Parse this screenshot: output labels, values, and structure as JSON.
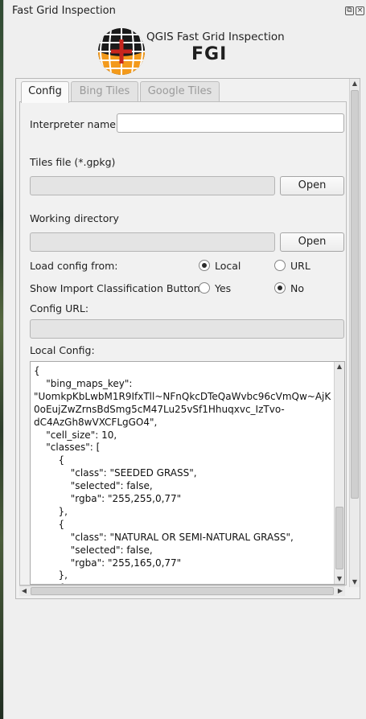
{
  "window": {
    "title": "Fast Grid Inspection"
  },
  "logo": {
    "line1": "QGIS Fast Grid Inspection",
    "line2": "FGI"
  },
  "tabs": [
    {
      "label": "Config",
      "active": true
    },
    {
      "label": "Bing Tiles",
      "active": false
    },
    {
      "label": "Google Tiles",
      "active": false
    }
  ],
  "config": {
    "interpreter_label": "Interpreter name",
    "interpreter_value": "",
    "tiles_file_label": "Tiles file (*.gpkg)",
    "tiles_file_value": "",
    "tiles_open": "Open",
    "working_dir_label": "Working directory",
    "working_dir_value": "",
    "working_dir_open": "Open",
    "load_from_label": "Load config from:",
    "load_from_options": [
      "Local",
      "URL"
    ],
    "load_from_selected": "Local",
    "import_btn_label": "Show Import Classification Button:",
    "import_btn_options": [
      "Yes",
      "No"
    ],
    "import_btn_selected": "No",
    "config_url_label": "Config URL:",
    "config_url_value": "",
    "local_config_label": "Local Config:",
    "local_config_lines": [
      "{",
      "    \"bing_maps_key\":",
      "\"UomkpKbLwbM1R9IfxTll~NFnQkcDTeQaWvbc96cVmQw~AjK",
      "0oEujZwZrnsBdSmg5cM47Lu25vSf1Hhuqxvc_IzTvo-",
      "dC4AzGh8wVXCFLgGO4\",",
      "    \"cell_size\": 10,",
      "    \"classes\": [",
      "        {",
      "            \"class\": \"SEEDED GRASS\",",
      "            \"selected\": false,",
      "            \"rgba\": \"255,255,0,77\"",
      "        },",
      "        {",
      "            \"class\": \"NATURAL OR SEMI-NATURAL GRASS\",",
      "            \"selected\": false,",
      "            \"rgba\": \"255,165,0,77\"",
      "        },",
      "        {"
    ]
  },
  "colors": {
    "logo_red": "#c8261e",
    "logo_orange": "#f39a1b",
    "logo_dark": "#1a1a1a"
  }
}
